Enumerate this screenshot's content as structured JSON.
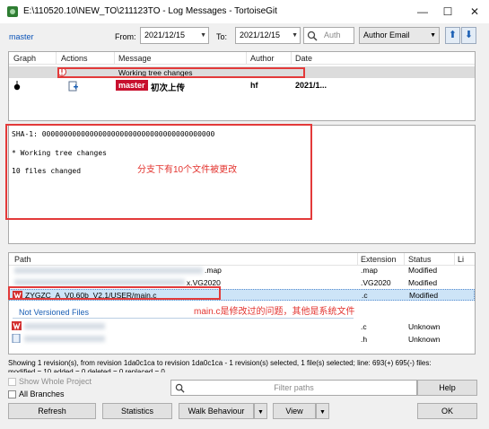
{
  "window": {
    "title": "E:\\110520.10\\NEW_TO\\211123TO - Log Messages - TortoiseGit",
    "min_icon": "minimize-icon",
    "max_icon": "maximize-icon",
    "close_icon": "close-icon"
  },
  "toolbar": {
    "branch_link": "master",
    "from_label": "From:",
    "from_date": "2021/12/15",
    "to_label": "To:",
    "to_date": "2021/12/15",
    "search_placeholder": "Auth",
    "filter_select": "Author Email",
    "up_arrow": "⬆",
    "down_arrow": "⬇"
  },
  "log_table": {
    "columns": [
      "Graph",
      "Actions",
      "Message",
      "Author",
      "Date"
    ],
    "rows": [
      {
        "message": "Working tree changes",
        "author": "",
        "date": ""
      },
      {
        "branch_tag": "master",
        "message": "初次上传",
        "author": "hf",
        "date": "2021/1..."
      }
    ]
  },
  "details": {
    "sha_line": "SHA-1: 0000000000000000000000000000000000000000",
    "summary": "* Working tree changes",
    "files_changed": "10 files changed",
    "annotation": "分支下有10个文件被更改"
  },
  "file_table": {
    "columns": [
      "Path",
      "Extension",
      "Status",
      "Li"
    ],
    "rows": [
      {
        "path_tail": ".map",
        "extension": ".map",
        "status": "Modified"
      },
      {
        "path_tail": "x.VG2020",
        "extension": ".VG2020",
        "status": "Modified"
      },
      {
        "path": "ZYGZC_A_V0.60b_V2.1/USER/main.c",
        "extension": ".c",
        "status": "Modified"
      }
    ],
    "group_label": "Not Versioned Files",
    "unversioned": [
      {
        "extension": ".c",
        "status": "Unknown"
      },
      {
        "extension": ".h",
        "status": "Unknown"
      }
    ],
    "annotation": "main.c是修改过的问题，其他是系统文件"
  },
  "status_bar": {
    "line1": "Showing 1 revision(s), from revision 1da0c1ca to revision 1da0c1ca - 1 revision(s) selected, 1 file(s) selected; line: 693(+) 695(-) files:",
    "line2": "modified = 10 added = 0 deleted = 0 replaced = 0"
  },
  "options": {
    "show_whole_project": "Show Whole Project",
    "all_branches": "All Branches",
    "filter_placeholder": "Filter paths"
  },
  "buttons": {
    "help": "Help",
    "refresh": "Refresh",
    "statistics": "Statistics",
    "walk_behaviour": "Walk Behaviour",
    "view": "View",
    "ok": "OK"
  },
  "colors": {
    "accent_blue": "#1a5fb4",
    "highlight_red": "#e33a3a",
    "branch_tag": "#c8102e",
    "selection": "#cde4f7"
  }
}
